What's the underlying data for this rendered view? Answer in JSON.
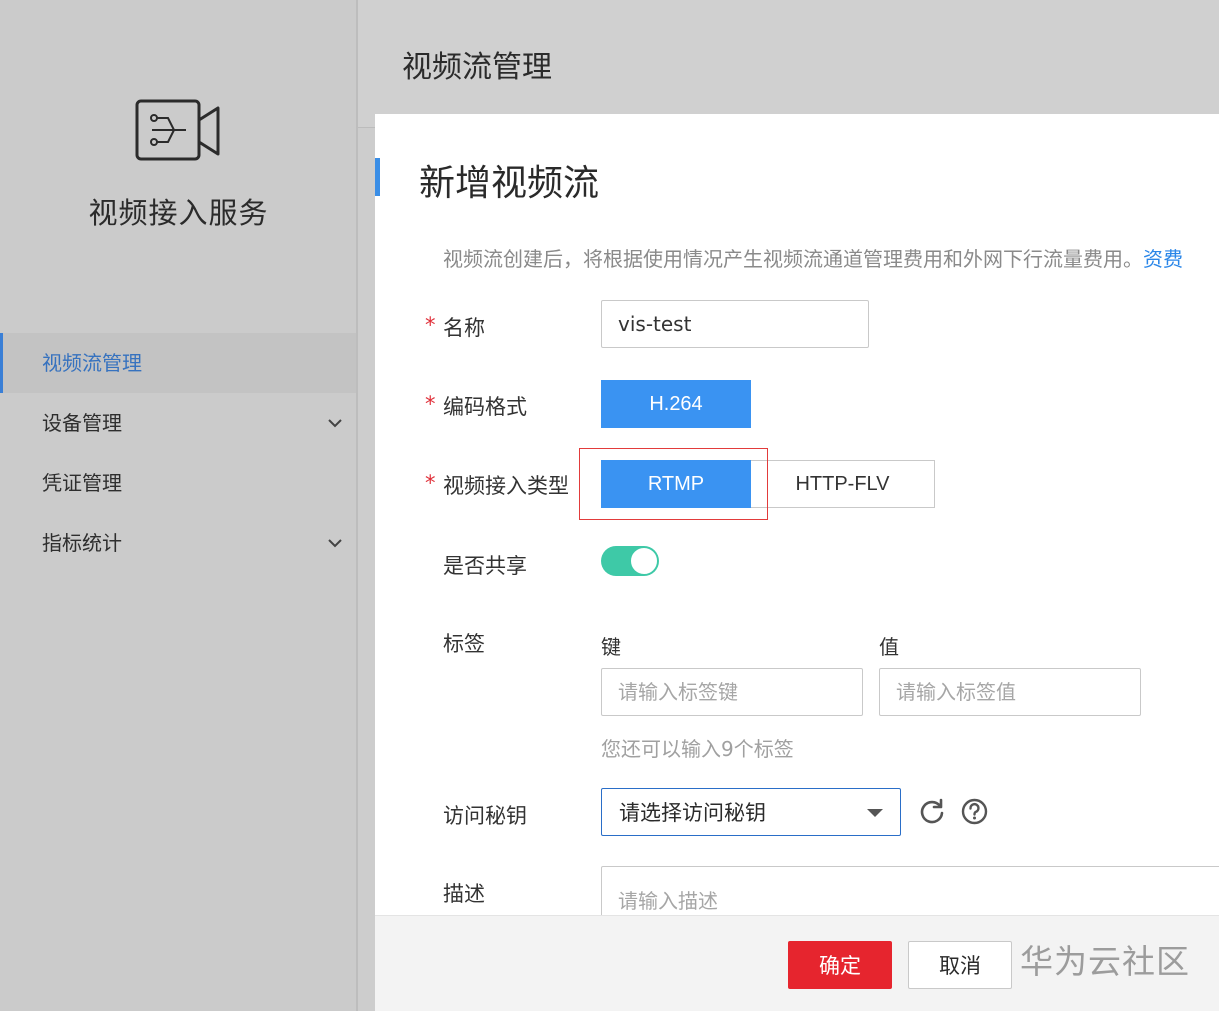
{
  "sidebar": {
    "service_name": "视频接入服务",
    "items": [
      {
        "label": "视频流管理",
        "active": true,
        "has_submenu": false
      },
      {
        "label": "设备管理",
        "active": false,
        "has_submenu": true
      },
      {
        "label": "凭证管理",
        "active": false,
        "has_submenu": false
      },
      {
        "label": "指标统计",
        "active": false,
        "has_submenu": true
      }
    ]
  },
  "header": {
    "title": "视频流管理"
  },
  "dialog": {
    "title": "新增视频流",
    "notice": "视频流创建后，将根据使用情况产生视频流通道管理费用和外网下行流量费用。",
    "notice_link": "资费",
    "name": {
      "label": "名称",
      "value": "vis-test"
    },
    "codec": {
      "label": "编码格式",
      "value": "H.264"
    },
    "access_type": {
      "label": "视频接入类型",
      "options": [
        "RTMP",
        "HTTP-FLV"
      ],
      "selected": "RTMP"
    },
    "share": {
      "label": "是否共享",
      "enabled": true
    },
    "tags": {
      "label": "标签",
      "key_label": "键",
      "value_label": "值",
      "key_placeholder": "请输入标签键",
      "value_placeholder": "请输入标签值",
      "hint": "您还可以输入9个标签"
    },
    "access_key": {
      "label": "访问秘钥",
      "placeholder": "请选择访问秘钥"
    },
    "description": {
      "label": "描述",
      "placeholder": "请输入描述"
    },
    "footer": {
      "confirm_label": "确定",
      "cancel_label": "取消"
    },
    "required_mark": "*"
  },
  "watermark": "华为云社区",
  "colors": {
    "primary_blue": "#3a93f2",
    "confirm_red": "#e6252e",
    "toggle_green": "#3ec9a7",
    "highlight_red": "#e23b3b",
    "active_nav": "#3672bf"
  }
}
